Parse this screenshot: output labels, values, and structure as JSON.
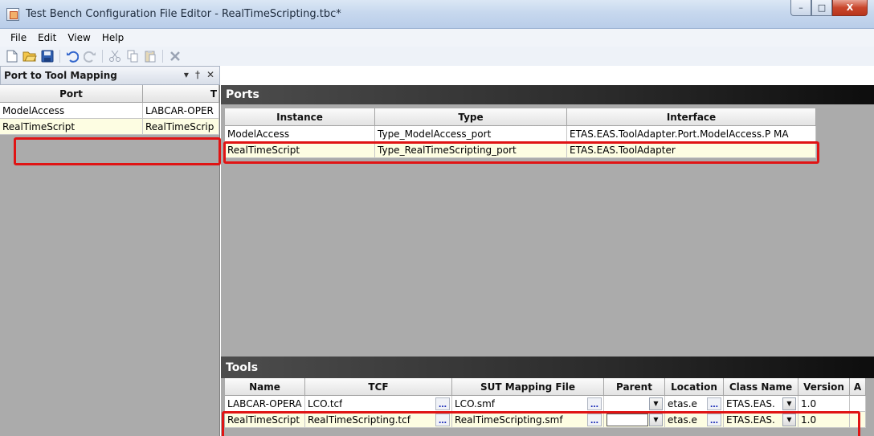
{
  "window": {
    "title": "Test Bench Configuration File Editor - RealTimeScripting.tbc*",
    "buttons": {
      "minimize": "–",
      "maximize": "□",
      "close": "X"
    }
  },
  "menu": [
    "File",
    "Edit",
    "View",
    "Help"
  ],
  "toolbar": [
    {
      "icon": "new-file-icon",
      "glyph": "🗋"
    },
    {
      "icon": "open-folder-icon",
      "glyph": "📂"
    },
    {
      "icon": "save-icon",
      "glyph": "💾"
    },
    {
      "icon": "undo-icon",
      "glyph": "↶"
    },
    {
      "icon": "redo-icon",
      "glyph": "↷"
    },
    {
      "icon": "cut-icon",
      "glyph": "✂"
    },
    {
      "icon": "copy-icon",
      "glyph": "⎘"
    },
    {
      "icon": "paste-icon",
      "glyph": "📋"
    },
    {
      "icon": "delete-icon",
      "glyph": "✖"
    }
  ],
  "left_panel": {
    "title": "Port to Tool Mapping",
    "controls": {
      "dropdown": "▾",
      "pin": "†",
      "close": "✕"
    },
    "columns": [
      "Port",
      "T"
    ],
    "rows": [
      [
        "ModelAccess",
        "LABCAR-OPER"
      ],
      [
        "RealTimeScript",
        "RealTimeScrip"
      ]
    ]
  },
  "ports": {
    "title": "Ports",
    "columns": [
      "Instance",
      "Type",
      "Interface"
    ],
    "rows": [
      [
        "ModelAccess",
        "Type_ModelAccess_port",
        "ETAS.EAS.ToolAdapter.Port.ModelAccess.P MA"
      ],
      [
        "RealTimeScript",
        "Type_RealTimeScripting_port",
        "ETAS.EAS.ToolAdapter"
      ]
    ]
  },
  "tools": {
    "title": "Tools",
    "columns": [
      "Name",
      "TCF",
      "SUT Mapping File",
      "Parent",
      "Location",
      "Class Name",
      "Version",
      "A"
    ],
    "rows": [
      {
        "name": "LABCAR-OPERA",
        "tcf": "LCO.tcf",
        "sut": "LCO.smf",
        "parent": "",
        "location": "etas.e",
        "class_name": "ETAS.EAS.",
        "version": "1.0"
      },
      {
        "name": "RealTimeScript",
        "tcf": "RealTimeScripting.tcf",
        "sut": "RealTimeScripting.smf",
        "parent": "",
        "location": "etas.e",
        "class_name": "ETAS.EAS.",
        "version": "1.0"
      }
    ],
    "ellipsis": "…",
    "dropdown": "▼"
  }
}
